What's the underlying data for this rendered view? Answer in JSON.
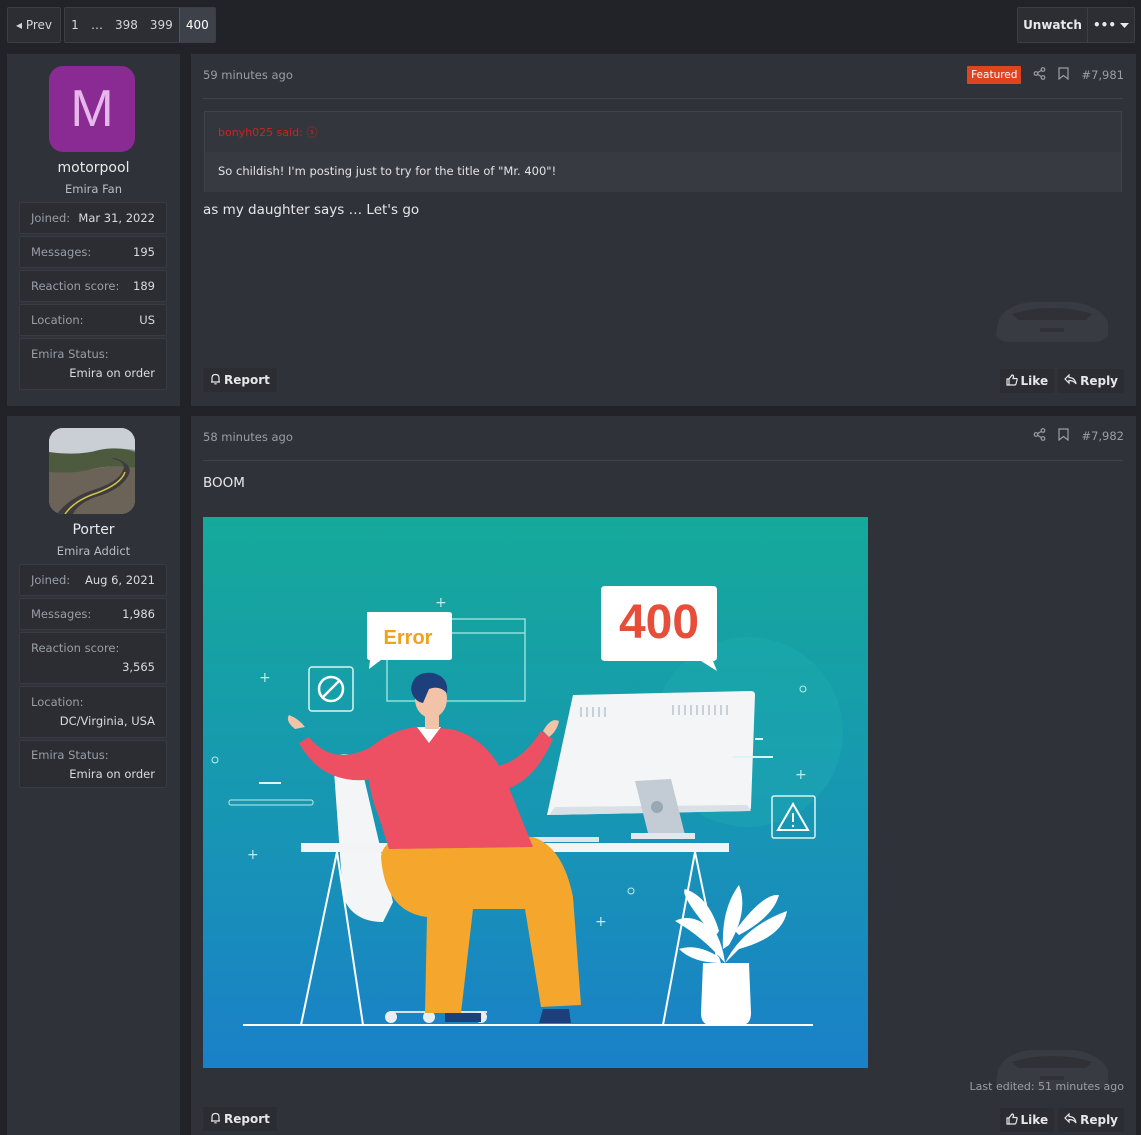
{
  "pagination": {
    "prev_label": "◂ Prev",
    "pages": [
      "1",
      "…",
      "398",
      "399",
      "400"
    ],
    "current": "400"
  },
  "toolbar": {
    "unwatch_label": "Unwatch",
    "more_label": "•••"
  },
  "colors": {
    "featured": "#e0441f",
    "avatar_m": "#8a2a93",
    "panel": "#30323a",
    "page_bg": "#212328"
  },
  "posts": [
    {
      "user": {
        "avatar_letter": "M",
        "name": "motorpool",
        "title": "Emira Fan",
        "stats": [
          {
            "k": "Joined:",
            "v": "Mar 31, 2022"
          },
          {
            "k": "Messages:",
            "v": "195"
          },
          {
            "k": "Reaction score:",
            "v": "189"
          },
          {
            "k": "Location:",
            "v": "US"
          },
          {
            "k": "Emira Status:",
            "v": "Emira on order"
          }
        ]
      },
      "time": "59 minutes ago",
      "badge": "Featured",
      "number": "#7,981",
      "quote": {
        "header": "bonyh025 said: ⓢ",
        "body": "So childish! I'm posting just to try for the title of \"Mr. 400\"!"
      },
      "message": "as my daughter says … Let's go",
      "report_label": "Report",
      "like_label": "Like",
      "reply_label": "Reply"
    },
    {
      "user": {
        "name": "Porter",
        "title": "Emira Addict",
        "stats": [
          {
            "k": "Joined:",
            "v": "Aug 6, 2021"
          },
          {
            "k": "Messages:",
            "v": "1,986"
          },
          {
            "k": "Reaction score:",
            "v": "3,565"
          },
          {
            "k": "Location:",
            "v": "DC/Virginia, USA"
          },
          {
            "k": "Emira Status:",
            "v": "Emira on order"
          }
        ]
      },
      "time": "58 minutes ago",
      "number": "#7,982",
      "message": "BOOM",
      "image": {
        "error_label": "Error",
        "code_label": "400"
      },
      "edited": "Last edited: 51 minutes ago",
      "report_label": "Report",
      "like_label": "Like",
      "reply_label": "Reply"
    }
  ]
}
